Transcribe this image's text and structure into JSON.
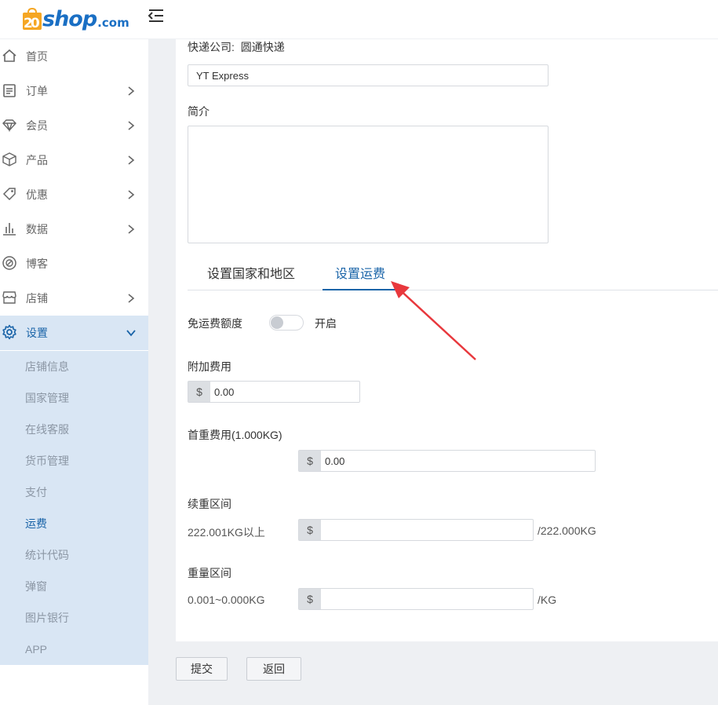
{
  "header": {
    "logo_number": "20",
    "logo_text": "shop",
    "logo_domain": ".com"
  },
  "sidebar": {
    "items": [
      {
        "label": "首页",
        "icon": "home-icon",
        "has_chevron": false
      },
      {
        "label": "订单",
        "icon": "clipboard-icon",
        "has_chevron": true
      },
      {
        "label": "会员",
        "icon": "diamond-icon",
        "has_chevron": true
      },
      {
        "label": "产品",
        "icon": "box-icon",
        "has_chevron": true
      },
      {
        "label": "优惠",
        "icon": "tag-icon",
        "has_chevron": true
      },
      {
        "label": "数据",
        "icon": "bar-chart-icon",
        "has_chevron": true
      },
      {
        "label": "博客",
        "icon": "blog-icon",
        "has_chevron": false
      },
      {
        "label": "店铺",
        "icon": "store-icon",
        "has_chevron": true
      },
      {
        "label": "设置",
        "icon": "gear-icon",
        "has_chevron": true,
        "active": true
      }
    ],
    "submenu": [
      {
        "label": "店铺信息"
      },
      {
        "label": "国家管理"
      },
      {
        "label": "在线客服"
      },
      {
        "label": "货币管理"
      },
      {
        "label": "支付"
      },
      {
        "label": "运费",
        "active": true
      },
      {
        "label": "统计代码"
      },
      {
        "label": "弹窗"
      },
      {
        "label": "图片银行"
      },
      {
        "label": "APP"
      }
    ]
  },
  "form": {
    "courier_label": "快递公司:",
    "courier_value": "圆通快递",
    "courier_en_value": "YT Express",
    "intro_label": "简介",
    "tabs": [
      {
        "label": "设置国家和地区"
      },
      {
        "label": "设置运费",
        "active": true
      }
    ],
    "free_shipping_label": "免运费额度",
    "free_shipping_toggle_label": "开启",
    "free_shipping_enabled": false,
    "extra_fee_label": "附加费用",
    "extra_fee_value": "0.00",
    "first_weight_label": "首重费用(1.000KG)",
    "first_weight_value": "0.00",
    "continued_weight_label": "续重区间",
    "continued_weight_range": "222.001KG以上",
    "continued_weight_suffix": "/222.000KG",
    "weight_range_label": "重量区间",
    "weight_range_text": "0.001~0.000KG",
    "weight_range_suffix": "/KG",
    "currency_symbol": "$"
  },
  "actions": {
    "submit_label": "提交",
    "back_label": "返回"
  },
  "colors": {
    "accent": "#1a64a8",
    "submenu_bg": "#d9e6f4",
    "annotation_arrow": "#e8383d",
    "logo_orange": "#f5a623",
    "logo_blue": "#1a6fc4"
  }
}
